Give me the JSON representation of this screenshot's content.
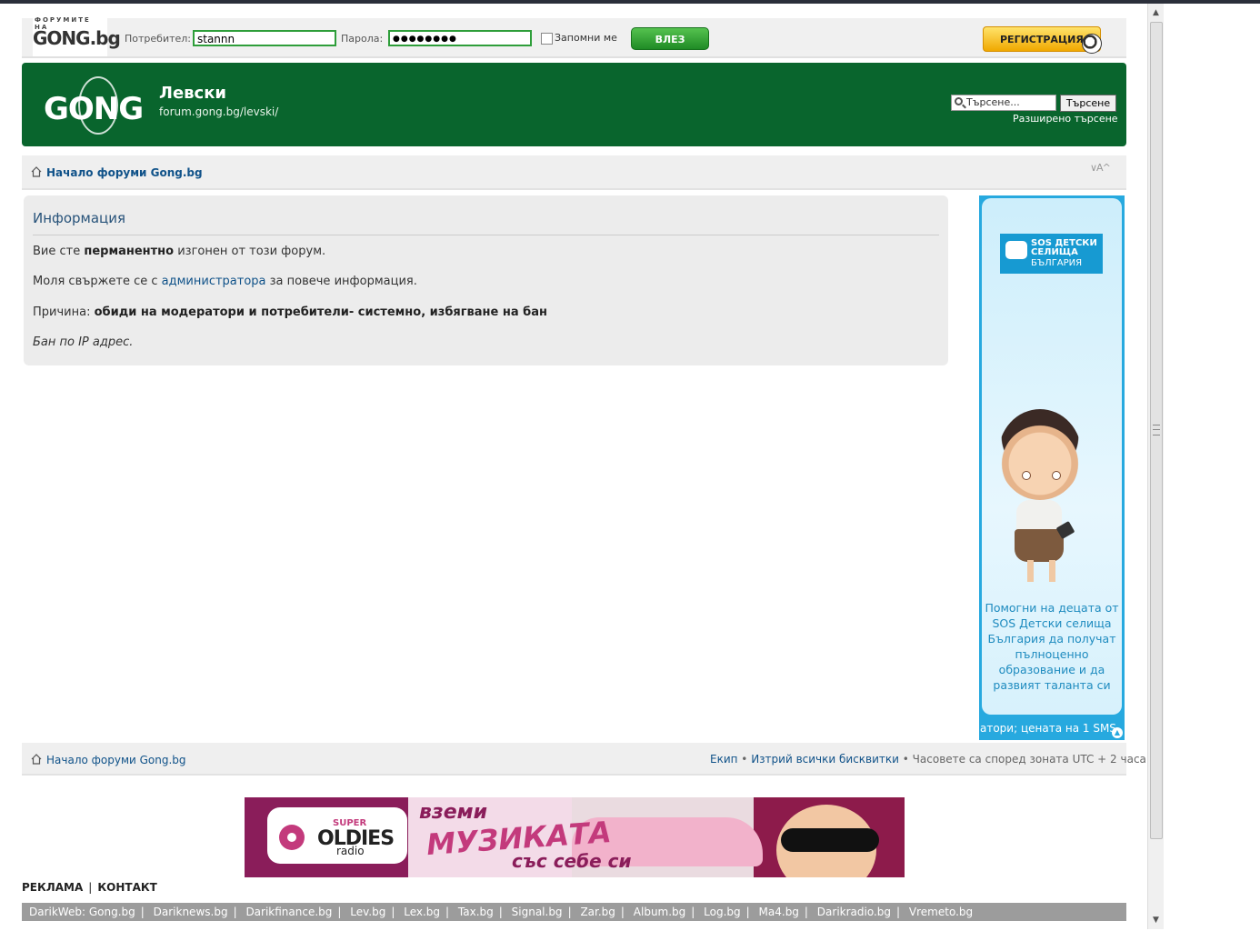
{
  "login": {
    "logo_tagline": "ФОРУМИТЕ НА",
    "logo_word": "GONG.bg",
    "username_label": "Потребител:",
    "username_value": "stannn",
    "password_label": "Парола:",
    "password_value": "●●●●●●●●",
    "remember_label": "Запомни ме",
    "login_button": "ВЛЕЗ",
    "register_button": "РЕГИСТРАЦИЯ"
  },
  "header": {
    "logo_text": "GONG",
    "title": "Левски",
    "url": "forum.gong.bg/levski/",
    "search_placeholder": "Търсене...",
    "search_button": "Търсене",
    "advanced_search": "Разширено търсене"
  },
  "nav": {
    "home": "Начало форуми Gong.bg",
    "font_change": "∨A^"
  },
  "info": {
    "title": "Информация",
    "line1_pre": "Вие сте ",
    "line1_bold": "перманентно",
    "line1_post": " изгонен от този форум.",
    "line2_pre": "Моля свържете се с ",
    "line2_link": "администратора",
    "line2_post": " за повече информация.",
    "line3_pre": "Причина: ",
    "line3_bold": "обиди на модератори и потребители- системно, избягване на бан",
    "line4": "Бан по IP адрес."
  },
  "ad": {
    "logo_line1": "SOS ДЕТСКИ",
    "logo_line2": "СЕЛИЩА",
    "logo_line3": "БЪЛГАРИЯ",
    "text": "Помогни на децата от SOS Детски селища България да получат пълноценно образование и да развият таланта си",
    "ticker": "атори; цената на 1 SMS"
  },
  "footer": {
    "home": "Начало форуми Gong.bg",
    "team": "Екип",
    "delete_cookies": "Изтрий всички бисквитки",
    "timezone": "Часовете са според зоната UTC + 2 часа"
  },
  "banner": {
    "super": "SUPER",
    "oldies": "OLDIES",
    "radio": "radio",
    "t1": "вземи",
    "t2": "МУЗИКАТА",
    "t3": "със себе си"
  },
  "bottom": {
    "ads": "РЕКЛАМА",
    "contact": "КОНТАКТ"
  },
  "network": {
    "label": "DarikWeb:",
    "sites": [
      "Gong.bg",
      "Dariknews.bg",
      "Darikfinance.bg",
      "Lev.bg",
      "Lex.bg",
      "Tax.bg",
      "Signal.bg",
      "Zar.bg",
      "Album.bg",
      "Log.bg",
      "Ma4.bg",
      "Darikradio.bg",
      "Vremeto.bg"
    ]
  }
}
